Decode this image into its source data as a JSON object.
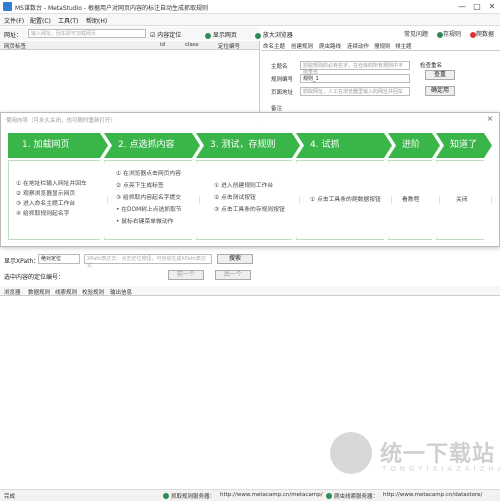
{
  "window": {
    "title": "MS谋数台 - MetaStudio - 根据用户对网页内容的标注自动生成抓取规则",
    "controls": [
      "—",
      "□",
      "✕"
    ]
  },
  "menu": {
    "items": [
      "文件(F)",
      "配置(C)",
      "工具(T)",
      "帮助(H)"
    ]
  },
  "toolbar_right": {
    "help": "常见问题",
    "save": "存规则",
    "crawl": "爬数据"
  },
  "url": {
    "label": "网址：",
    "placeholder": "输入网址，回车即可加载网页",
    "locate": "内容定位",
    "show_page": "显示网页",
    "browser": "放大浏览器"
  },
  "left_table": {
    "headers": [
      "网页标签",
      "id",
      "class",
      "定位编号"
    ]
  },
  "right": {
    "tabs": [
      "命名主题",
      "创建规则",
      "爬虫路线",
      "连续动作",
      "搜规则",
      "排主题"
    ],
    "fields": [
      {
        "label": "主题名",
        "placeholder": "抓取规则的必有名字，在仓库的所有规则中不能重名"
      },
      {
        "label": "规则编号",
        "value": "规则_1"
      },
      {
        "label": "页面地址",
        "placeholder": "抓取网址，人工在浏览器里输入的网址并回车"
      }
    ],
    "check_name": "检查重名",
    "btn_query": "查重",
    "btn_ok": "确定用",
    "note": "备注"
  },
  "overlay": {
    "hint": "使用向导（可永久关闭，也可随时重新打开）",
    "close": "×",
    "steps": [
      {
        "title": "1. 加载网页",
        "items": [
          "① 在地址栏输入网址并回车",
          "② 观察浏览器显示网页",
          "③ 进入命名主题工作台",
          "④ 给抓取规则起名字"
        ]
      },
      {
        "title": "2. 点选抓内容",
        "items": [
          "① 在浏览器点击网页内容",
          "② 点亮下生成标签",
          "③ 给抓取内容起名字提交",
          "• 在DOM树上点选抓取节",
          "• 鼠标右键菜单做动作"
        ]
      },
      {
        "title": "3. 测试，存规则",
        "items": [
          "① 进入创建规则工作台",
          "② 点击测试按钮",
          "③ 点击工具条的存规则按钮"
        ]
      },
      {
        "title": "4. 试抓",
        "items": [
          "① 点击工具条的爬数据按钮"
        ]
      },
      {
        "title": "进阶",
        "items": [
          "看教程"
        ]
      },
      {
        "title": "知道了",
        "items": [
          "关闭"
        ]
      }
    ]
  },
  "xpath": {
    "label": "显示XPath：",
    "select": "绝对定位",
    "placeholder": "XPath表达式：点击定位按钮，可自动生成XPath表达式",
    "search": "搜索",
    "node_label": "选中内容的定位编号：",
    "prev": "前一个",
    "next": "后一个"
  },
  "bottom_tabs": [
    "浏览器",
    "数据规则",
    "线索规则",
    "校验规则",
    "输出信息"
  ],
  "status": {
    "left": "完成",
    "server1_label": "抓取规则服务器：",
    "server1_url": "http://www.metacamp.cn/metacamp/",
    "server2_label": "爬虫线索服务器：",
    "server2_url": "http://www.metacamp.cn/datastore/"
  },
  "watermark": {
    "title": "统一下载站",
    "sub": "TONGYIXIAZAIZHAN"
  },
  "colors": {
    "accent": "#39b54a",
    "brand": "#2f7fd0"
  }
}
